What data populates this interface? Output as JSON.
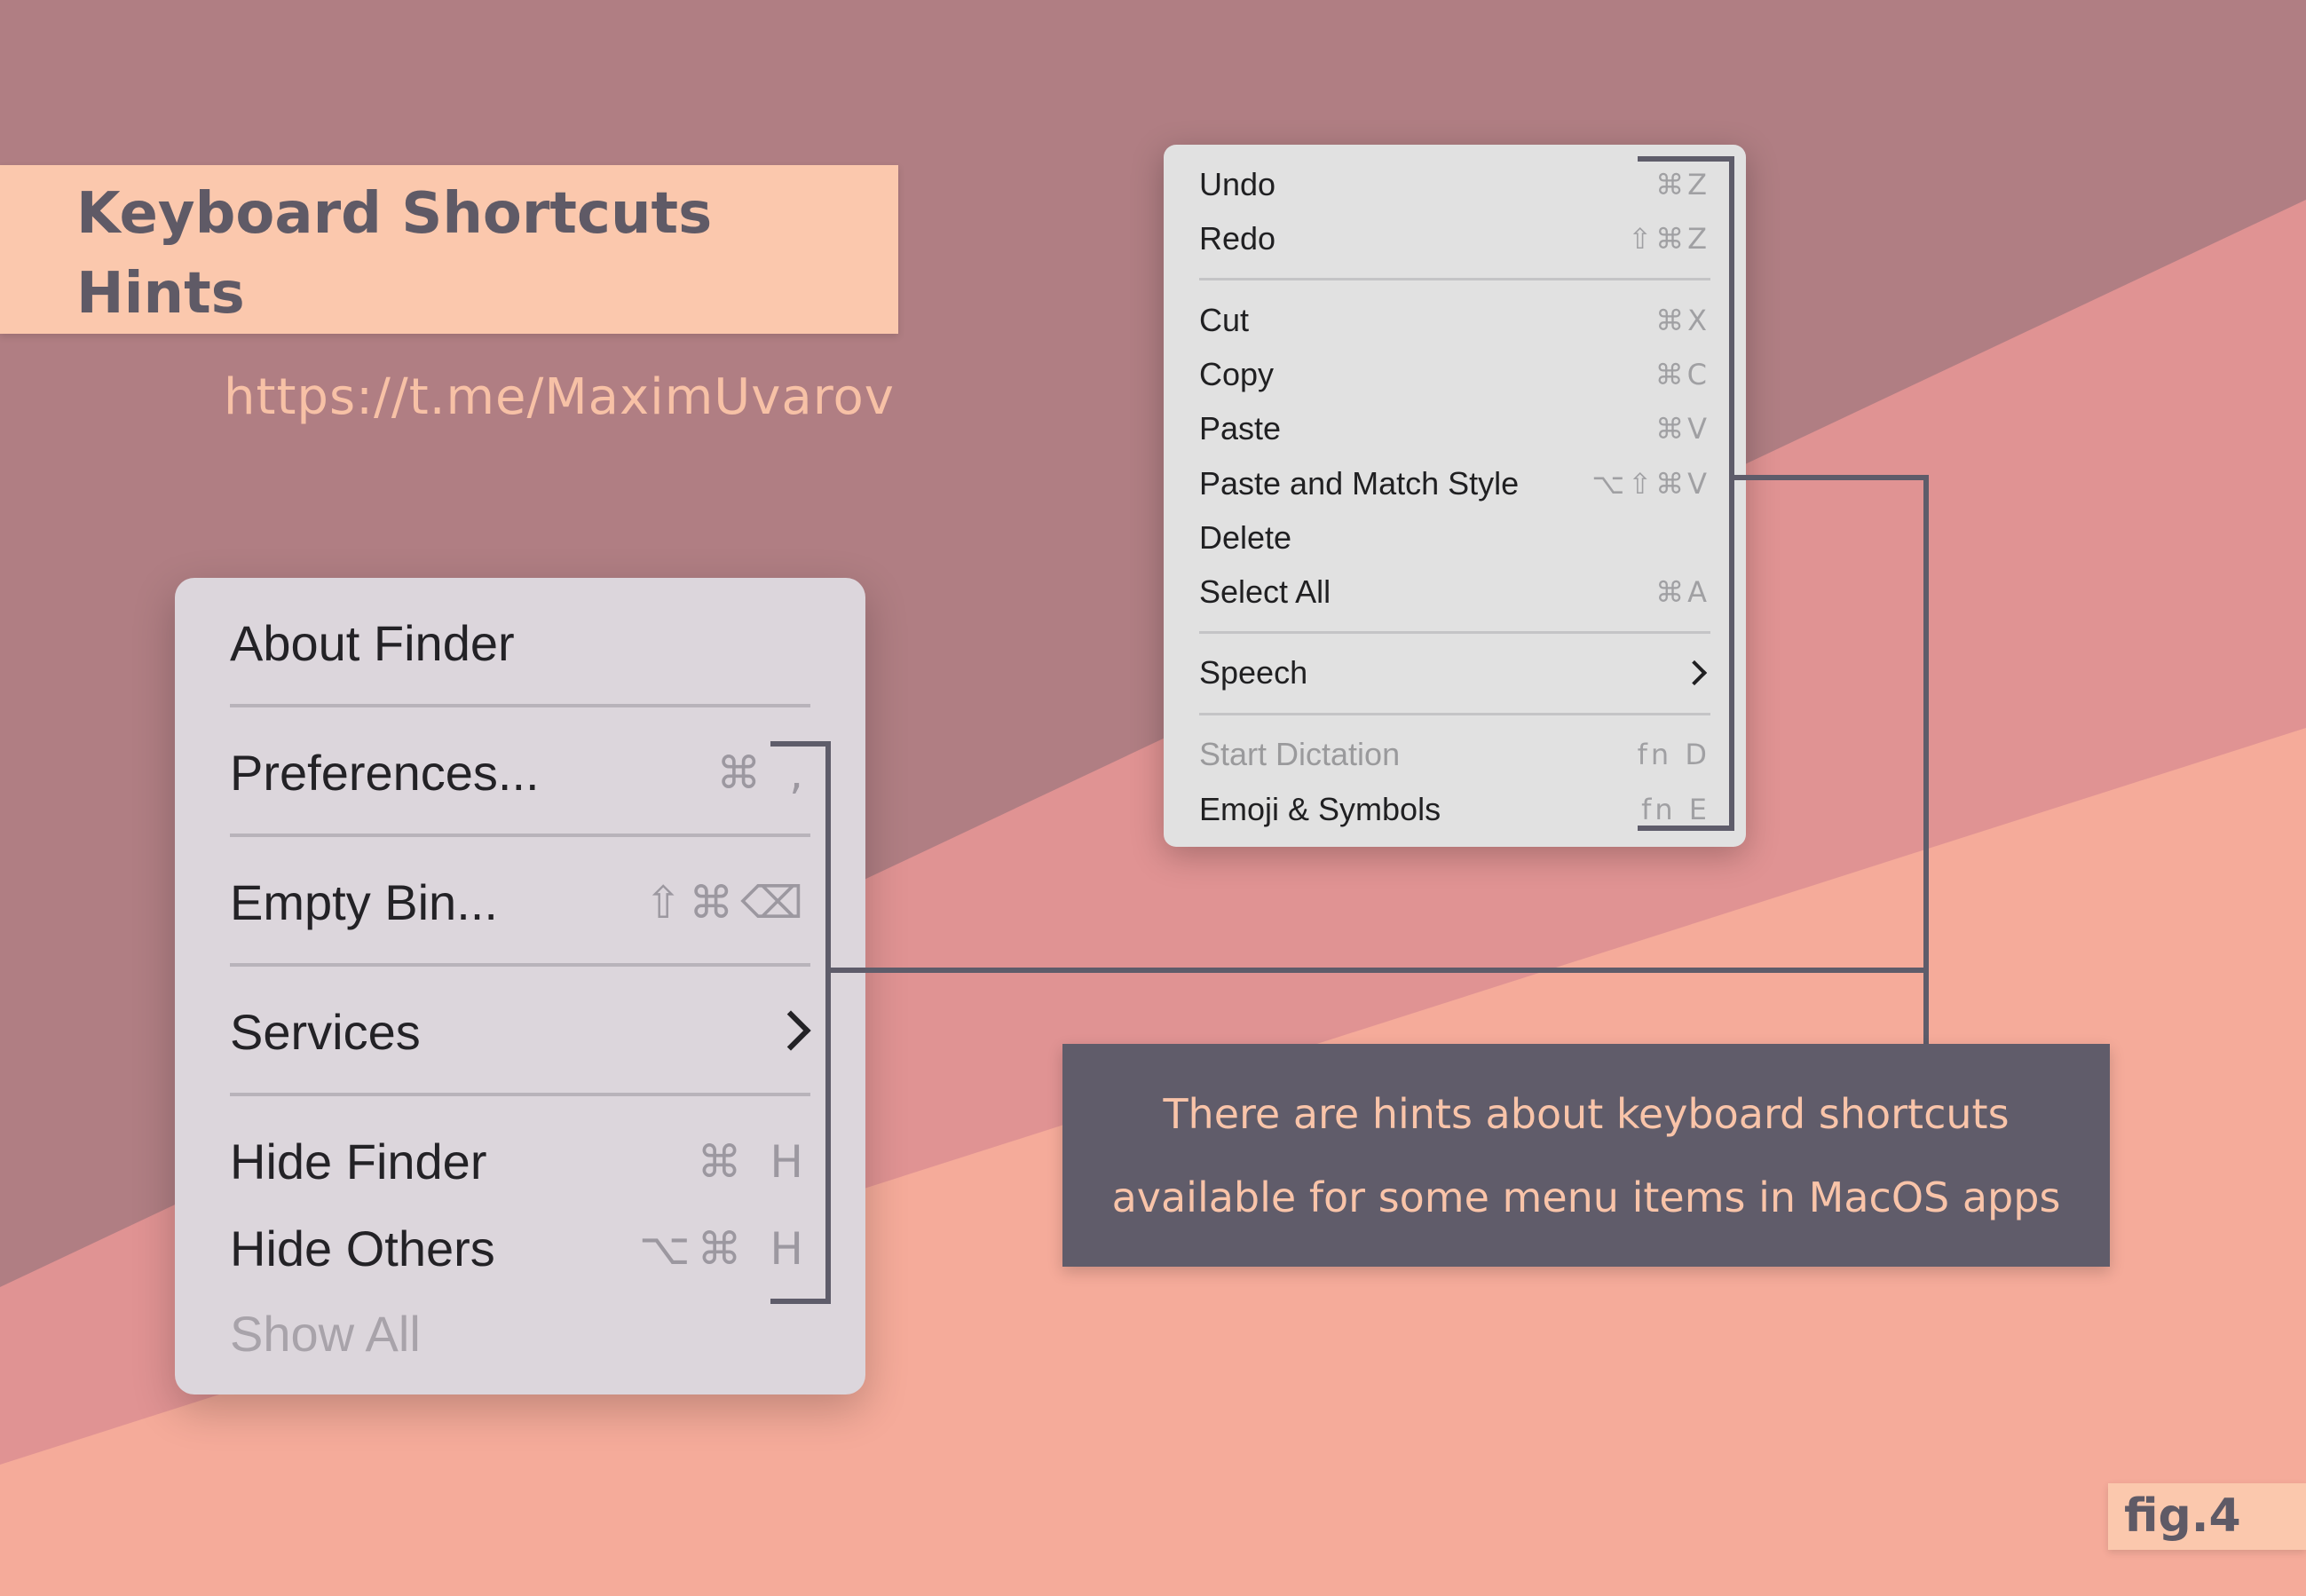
{
  "title": {
    "line1": "Keyboard Shortcuts",
    "line2": "Hints"
  },
  "url": "https://t.me/MaximUvarov",
  "colors": {
    "bg_top": "#b07e83",
    "bg_mid": "#e09393",
    "bg_bottom": "#f5ab9a",
    "title_box": "#fbc8ad",
    "text_dark": "#5f5a66",
    "accent_peach": "#f9c4a9",
    "hint_box": "#605c6a",
    "connector": "#5e5c6a"
  },
  "finder_menu": {
    "items": [
      {
        "label": "About Finder",
        "shortcut": ""
      },
      {
        "label": "Preferences...",
        "shortcut": "⌘ ,"
      },
      {
        "label": "Empty Bin...",
        "shortcut": "⇧⌘⌫"
      },
      {
        "label": "Services",
        "shortcut": "",
        "submenu_icon": "chevron-right-icon"
      },
      {
        "label": "Hide Finder",
        "shortcut": "⌘ H"
      },
      {
        "label": "Hide Others",
        "shortcut": "⌥⌘ H"
      },
      {
        "label": "Show All",
        "shortcut": "",
        "disabled": true
      }
    ]
  },
  "edit_menu": {
    "items": [
      {
        "label": "Undo",
        "shortcut": "⌘Z"
      },
      {
        "label": "Redo",
        "shortcut": "⇧⌘Z"
      },
      {
        "label": "Cut",
        "shortcut": "⌘X"
      },
      {
        "label": "Copy",
        "shortcut": "⌘C"
      },
      {
        "label": "Paste",
        "shortcut": "⌘V"
      },
      {
        "label": "Paste and Match Style",
        "shortcut": "⌥⇧⌘V"
      },
      {
        "label": "Delete",
        "shortcut": ""
      },
      {
        "label": "Select All",
        "shortcut": "⌘A"
      },
      {
        "label": "Speech",
        "shortcut": "",
        "submenu_icon": "chevron-right-icon"
      },
      {
        "label": "Start Dictation",
        "shortcut": "fn D",
        "disabled": true
      },
      {
        "label": "Emoji & Symbols",
        "shortcut": "fn E"
      }
    ]
  },
  "hint": {
    "line1": "There are hints about keyboard shortcuts",
    "line2": "available for some menu items in MacOS apps"
  },
  "figure_label": "fig.4"
}
